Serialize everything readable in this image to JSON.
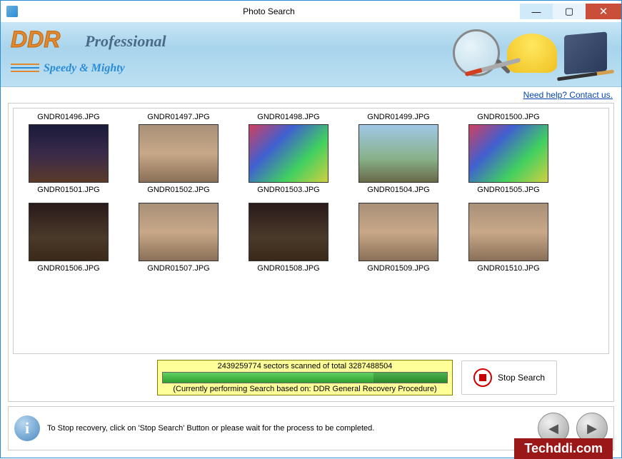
{
  "window": {
    "title": "Photo Search"
  },
  "banner": {
    "brand": "DDR",
    "product": "Professional",
    "tagline": "Speedy & Mighty"
  },
  "help_link": "Need help? Contact us.",
  "files": {
    "row0": [
      "GNDR01496.JPG",
      "GNDR01497.JPG",
      "GNDR01498.JPG",
      "GNDR01499.JPG",
      "GNDR01500.JPG"
    ],
    "row1": [
      "GNDR01501.JPG",
      "GNDR01502.JPG",
      "GNDR01503.JPG",
      "GNDR01504.JPG",
      "GNDR01505.JPG"
    ],
    "row2": [
      "GNDR01506.JPG",
      "GNDR01507.JPG",
      "GNDR01508.JPG",
      "GNDR01509.JPG",
      "GNDR01510.JPG"
    ]
  },
  "progress": {
    "sectors_scanned": 2439259774,
    "sectors_total": 3287488504,
    "scanline": "2439259774 sectors scanned of total 3287488504",
    "procedure": "(Currently performing Search based on:  DDR General Recovery Procedure)"
  },
  "buttons": {
    "stop": "Stop Search"
  },
  "footer": {
    "hint": "To Stop recovery, click on 'Stop Search' Button or please wait for the process to be completed."
  },
  "watermark": "Techddi.com"
}
